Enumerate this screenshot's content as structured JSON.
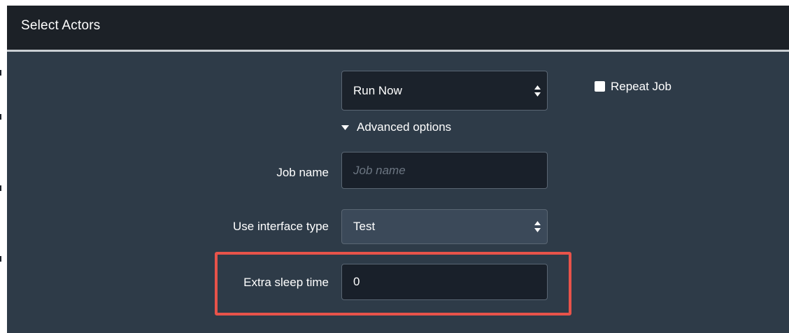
{
  "header": {
    "title": "Select Actors"
  },
  "schedule": {
    "selected": "Run Now"
  },
  "repeat": {
    "label": "Repeat Job",
    "checked": false
  },
  "advanced": {
    "label": "Advanced options",
    "expanded": true
  },
  "job_name": {
    "label": "Job name",
    "value": "",
    "placeholder": "Job name"
  },
  "interface_type": {
    "label": "Use interface type",
    "selected": "Test"
  },
  "sleep_time": {
    "label": "Extra sleep time",
    "value": "0"
  },
  "colors": {
    "highlight": "#e8534a",
    "panel": "#2e3b48",
    "header": "#1c2127"
  }
}
